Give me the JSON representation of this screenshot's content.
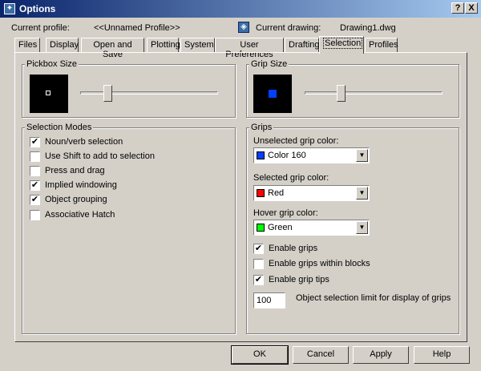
{
  "window": {
    "title": "Options",
    "help_btn": "?",
    "close_btn": "X"
  },
  "header": {
    "profile_label": "Current profile:",
    "profile_value": "<<Unnamed Profile>>",
    "drawing_label": "Current drawing:",
    "drawing_value": "Drawing1.dwg"
  },
  "tabs": [
    "Files",
    "Display",
    "Open and Save",
    "Plotting",
    "System",
    "User Preferences",
    "Drafting",
    "Selection",
    "Profiles"
  ],
  "active_tab": "Selection",
  "pickbox": {
    "label": "Pickbox Size",
    "level": 0.18
  },
  "gripsize": {
    "label": "Grip Size",
    "level": 0.25
  },
  "selection_modes": {
    "label": "Selection Modes",
    "items": [
      {
        "label": "Noun/verb selection",
        "checked": true
      },
      {
        "label": "Use Shift to add to selection",
        "checked": false
      },
      {
        "label": "Press and drag",
        "checked": false
      },
      {
        "label": "Implied windowing",
        "checked": true
      },
      {
        "label": "Object grouping",
        "checked": true
      },
      {
        "label": "Associative Hatch",
        "checked": false
      }
    ]
  },
  "grips": {
    "label": "Grips",
    "unselected_label": "Unselected grip color:",
    "unselected_value": "Color 160",
    "unselected_color": "#0040ff",
    "selected_label": "Selected grip color:",
    "selected_value": "Red",
    "selected_color": "#ff0000",
    "hover_label": "Hover grip color:",
    "hover_value": "Green",
    "hover_color": "#00ff00",
    "checks": [
      {
        "label": "Enable grips",
        "checked": true
      },
      {
        "label": "Enable grips within blocks",
        "checked": false
      },
      {
        "label": "Enable grip tips",
        "checked": true
      }
    ],
    "limit_value": "100",
    "limit_label": "Object selection limit for display of grips"
  },
  "buttons": {
    "ok": "OK",
    "cancel": "Cancel",
    "apply": "Apply",
    "help": "Help"
  }
}
